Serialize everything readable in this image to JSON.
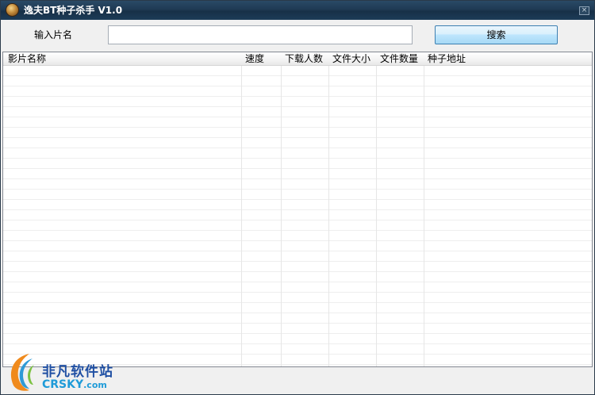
{
  "window": {
    "title": "逸夫BT种子杀手 V1.0",
    "close_symbol": "×"
  },
  "search": {
    "label": "输入片名",
    "value": "",
    "placeholder": "",
    "button_label": "搜索"
  },
  "list": {
    "columns": [
      {
        "key": "name",
        "label": "影片名称"
      },
      {
        "key": "speed",
        "label": "速度"
      },
      {
        "key": "downloaders",
        "label": "下载人数"
      },
      {
        "key": "size",
        "label": "文件大小"
      },
      {
        "key": "file_count",
        "label": "文件数量"
      },
      {
        "key": "torrent_url",
        "label": "种子地址"
      }
    ],
    "rows": []
  },
  "watermark": {
    "name_cn": "非凡软件站",
    "brand": "CRSKY",
    "domain": ".com"
  },
  "icons": {
    "app": "coin-icon",
    "close": "close-icon",
    "watermark_logo": "crescent-logo-icon"
  }
}
